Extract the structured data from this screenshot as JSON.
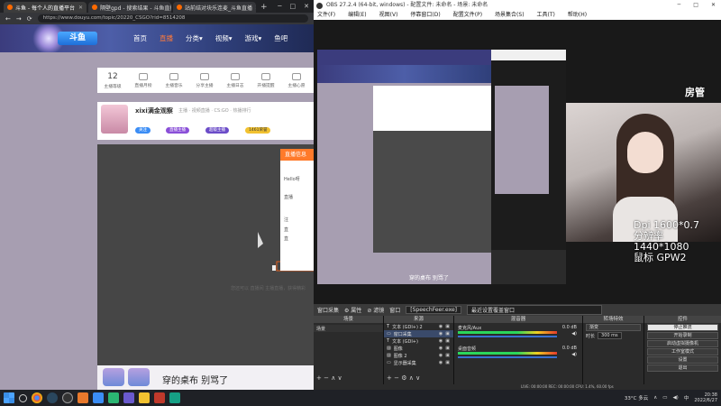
{
  "browser": {
    "tabs": [
      {
        "label": "斗鱼 - 每个人的直播平台"
      },
      {
        "label": "隔壁gpd - 搜索结果 - 斗鱼直播"
      },
      {
        "label": "站前结对块乐连麦_斗鱼直播"
      }
    ],
    "new_tab": "+",
    "window_controls": [
      "─",
      "□",
      "✕"
    ],
    "url": "https://www.douyu.com/topic/20220_CSGO?rid=8514208"
  },
  "site": {
    "logo": "斗鱼",
    "nav": [
      "首页",
      "直播",
      "分类",
      "视频",
      "游戏",
      "鱼吧"
    ],
    "nav_arrows": [
      "",
      "",
      "▾",
      "▾",
      "▾",
      ""
    ]
  },
  "icon_row": {
    "count": "12",
    "items": [
      "主播等级",
      "直播月榜",
      "主播音乐",
      "分享主播",
      "主播日志",
      "开播提醒",
      "主播心愿",
      ""
    ]
  },
  "streamer": {
    "name": "xixi满金观察",
    "meta": "主播 · 视频直播 · CS:GO · 热播排行",
    "badges": [
      "关注",
      "直播主播",
      "超级主播",
      "1461荣誉"
    ],
    "follow": "关注"
  },
  "dialog": {
    "title": "直播信息",
    "lines": [
      "Hello呀",
      "直播",
      "注",
      "直",
      "直"
    ]
  },
  "notice": "您还可以 直播间 主播直播，获得精彩",
  "danmu": {
    "text": "穿的桌布 别骂了"
  },
  "obs": {
    "title": "OBS 27.2.4 (64-bit, windows) - 配置文件: 未命名 - 场景: 未命名",
    "window_controls": [
      "─",
      "□",
      "✕"
    ],
    "menu": [
      "文件(F)",
      "编辑(E)",
      "视图(V)",
      "停靠窗口(D)",
      "配置文件(P)",
      "场景集合(S)",
      "工具(T)",
      "帮助(H)"
    ],
    "nested_text": "穿的桌布 别骂了",
    "overlay": [
      "Dpi 1600*0.7",
      "分辨率 1440*1080",
      "鼠标 GPW2"
    ],
    "overlay_logo": "房管",
    "toolbar": [
      "窗口采集",
      "⚙ 属性",
      "⊘ 滤镜",
      "窗口",
      "[SpeechFeer.exe]",
      "最近设置覆盖窗口"
    ],
    "docks": {
      "scenes": {
        "header": "场景",
        "items": [
          "场景"
        ]
      },
      "sources": {
        "header": "来源",
        "items": [
          "文本 (GDI+) 2",
          "窗口采集",
          "文本 (GDI+)",
          "图像",
          "图像 2",
          "显示器采集"
        ]
      },
      "mixer": {
        "header": "混音器",
        "channels": [
          {
            "name": "麦克风/Aux",
            "db": "0.0 dB"
          },
          {
            "name": "桌面音频",
            "db": "0.0 dB"
          }
        ]
      },
      "transitions": {
        "header": "转场特效",
        "type": "渐变",
        "duration_label": "时长",
        "duration": "300 ms"
      },
      "controls": {
        "header": "控件",
        "buttons": [
          "停止推流",
          "开始录制",
          "启动虚拟摄像机",
          "工作室模式",
          "设置",
          "退出"
        ]
      }
    },
    "status": "LIVE: 00:00:00   REC: 00:00:00   CPU: 1.4%, 60.00 fps"
  },
  "taskbar": {
    "weather": "33°C 多云",
    "time": "20:38",
    "date": "2022/6/27",
    "lang": "中"
  },
  "colors": {
    "accent": "#ff7a2a",
    "site_header": "#3b3c7d",
    "page_bg": "#a79eb1",
    "obs_bg": "#2b2b2b"
  }
}
